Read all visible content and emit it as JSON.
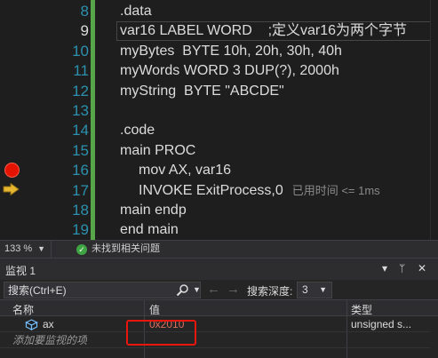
{
  "editor": {
    "line_numbers": [
      "8",
      "9",
      "10",
      "11",
      "12",
      "13",
      "14",
      "15",
      "16",
      "17",
      "18",
      "19"
    ],
    "current_line": "9",
    "lines": [
      {
        "text": ".data",
        "indent": 0
      },
      {
        "text": "var16 LABEL WORD    ;定义var16为两个字节",
        "indent": 0
      },
      {
        "text": "myBytes  BYTE 10h, 20h, 30h, 40h",
        "indent": 0
      },
      {
        "text": "myWords WORD 3 DUP(?), 2000h",
        "indent": 0
      },
      {
        "text": "myString  BYTE \"ABCDE\"",
        "indent": 0
      },
      {
        "text": "",
        "indent": 0
      },
      {
        "text": ".code",
        "indent": 0
      },
      {
        "text": "main PROC",
        "indent": 0
      },
      {
        "text": "mov AX, var16",
        "indent": 1
      },
      {
        "text": "INVOKE ExitProcess,0",
        "indent": 1,
        "hint": "已用时间 <= 1ms"
      },
      {
        "text": "main endp",
        "indent": 0
      },
      {
        "text": "end main",
        "indent": 0
      }
    ],
    "breakpoint_line": "16",
    "execution_line": "17"
  },
  "status_bar": {
    "zoom": "133 %",
    "issues": "未找到相关问题"
  },
  "watch": {
    "title": "监视 1",
    "search_placeholder": "搜索(Ctrl+E)",
    "depth_label": "搜索深度:",
    "depth_value": "3",
    "columns": {
      "name": "名称",
      "value": "值",
      "type": "类型"
    },
    "rows": [
      {
        "name": "ax",
        "value": "0x2010",
        "type": "unsigned s..."
      }
    ],
    "add_item": "添加要监视的项"
  },
  "colors": {
    "background": "#1e1e1e",
    "line_number": "#2b91af",
    "change_bar": "#57a64a",
    "breakpoint": "#e51400",
    "exec_arrow": "#e8b731",
    "changed_value": "#e06c5a",
    "highlight_box": "#e8160c"
  }
}
